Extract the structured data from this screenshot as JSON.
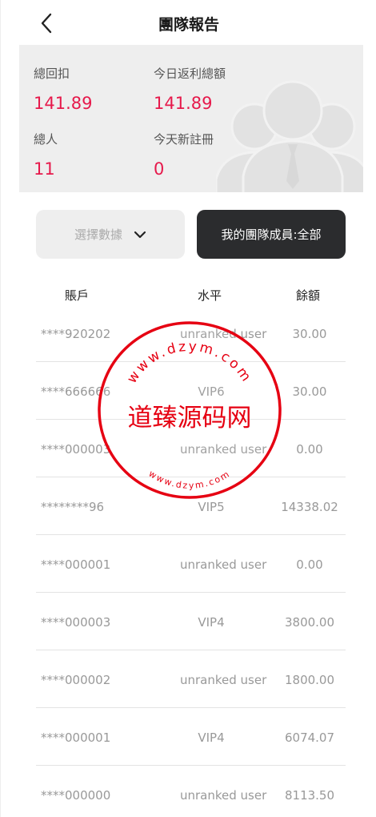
{
  "header": {
    "title": "團隊報告"
  },
  "summary": {
    "stats": [
      {
        "label": "總回扣",
        "value": "141.89"
      },
      {
        "label": "今日返利總額",
        "value": "141.89"
      },
      {
        "label": "總人",
        "value": "11"
      },
      {
        "label": "今天新註冊",
        "value": "0"
      }
    ]
  },
  "filters": {
    "select_label": "選擇數據",
    "members_label": "我的團隊成員:全部"
  },
  "table": {
    "columns": [
      "賬戶",
      "水平",
      "餘額"
    ],
    "rows": [
      {
        "account": "****920202",
        "level": "unranked user",
        "balance": "30.00"
      },
      {
        "account": "****666666",
        "level": "VIP6",
        "balance": "30.00"
      },
      {
        "account": "****000003",
        "level": "unranked user",
        "balance": "0.00"
      },
      {
        "account": "********96",
        "level": "VIP5",
        "balance": "14338.02"
      },
      {
        "account": "****000001",
        "level": "unranked user",
        "balance": "0.00"
      },
      {
        "account": "****000003",
        "level": "VIP4",
        "balance": "3800.00"
      },
      {
        "account": "****000002",
        "level": "unranked user",
        "balance": "1800.00"
      },
      {
        "account": "****000001",
        "level": "VIP4",
        "balance": "6074.07"
      },
      {
        "account": "****000000",
        "level": "unranked user",
        "balance": "8113.50"
      }
    ]
  },
  "watermark": {
    "text": "道臻源码网",
    "url": "www.dzym.com"
  },
  "colors": {
    "accent": "#e6194b",
    "dark_button": "#2b2c2e",
    "stamp": "#e60012"
  }
}
